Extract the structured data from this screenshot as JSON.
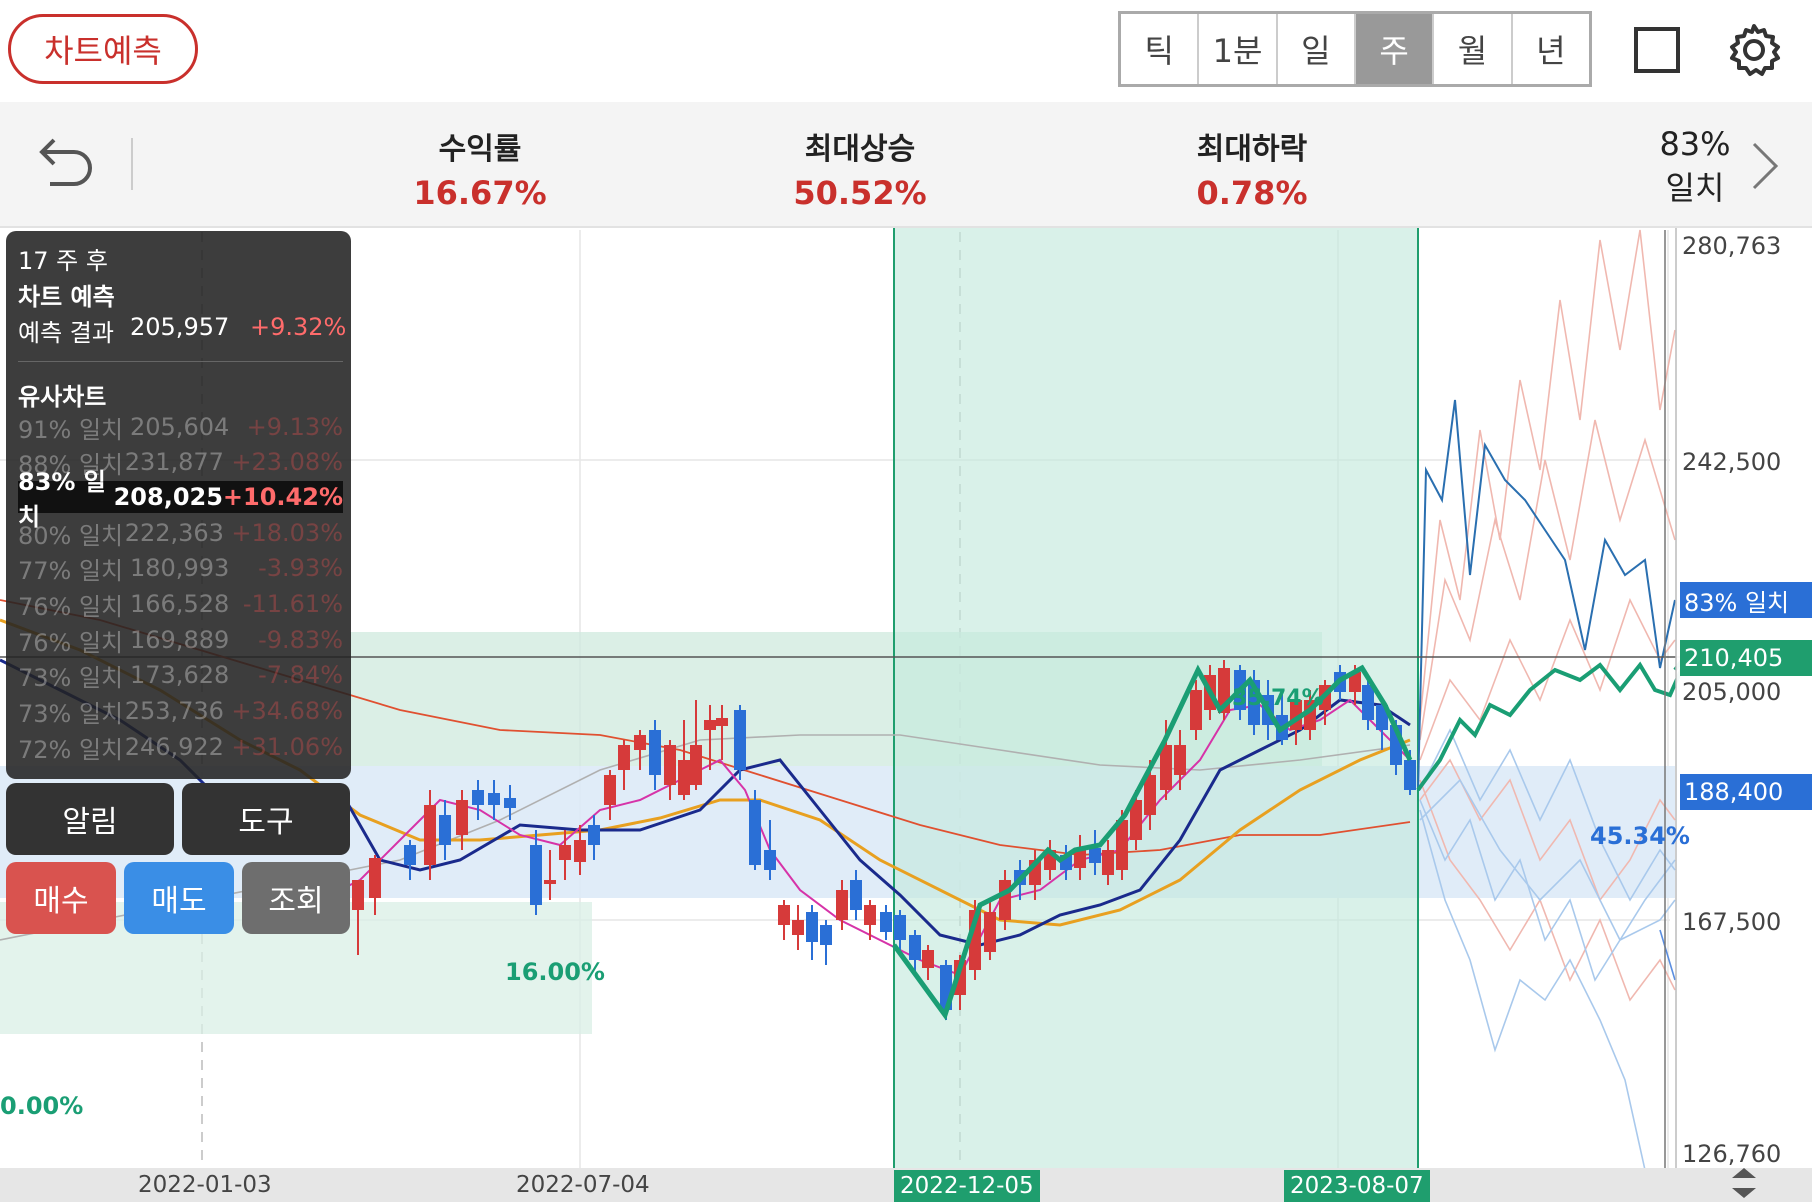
{
  "header": {
    "predict_button": "차트예측",
    "periods": [
      "틱",
      "1분",
      "일",
      "주",
      "월",
      "년"
    ],
    "active_period": "주"
  },
  "stats": {
    "return_label": "수익률",
    "return_value": "16.67%",
    "max_up_label": "최대상승",
    "max_up_value": "50.52%",
    "max_down_label": "최대하락",
    "max_down_value": "0.78%",
    "match_pct": "83%",
    "match_label": "일치"
  },
  "tooltip": {
    "weeks_after": "17 주 후",
    "title": "차트 예측",
    "result_label": "예측 결과",
    "result_value": "205,957",
    "result_change": "+9.32%",
    "similar_title": "유사차트",
    "similar": [
      {
        "pct": "91% 일치",
        "price": "205,604",
        "chg": "+9.13%"
      },
      {
        "pct": "88% 일치",
        "price": "231,877",
        "chg": "+23.08%"
      },
      {
        "pct": "83% 일치",
        "price": "208,025",
        "chg": "+10.42%"
      },
      {
        "pct": "80% 일치",
        "price": "222,363",
        "chg": "+18.03%"
      },
      {
        "pct": "77% 일치",
        "price": "180,993",
        "chg": "-3.93%"
      },
      {
        "pct": "76% 일치",
        "price": "166,528",
        "chg": "-11.61%"
      },
      {
        "pct": "76% 일치",
        "price": "169,889",
        "chg": "-9.83%"
      },
      {
        "pct": "73% 일치",
        "price": "173,628",
        "chg": "-7.84%"
      },
      {
        "pct": "73% 일치",
        "price": "253,736",
        "chg": "+34.68%"
      },
      {
        "pct": "72% 일치",
        "price": "246,922",
        "chg": "+31.06%"
      }
    ]
  },
  "buttons": {
    "alert": "알림",
    "tools": "도구",
    "buy": "매수",
    "sell": "매도",
    "query": "조회"
  },
  "chart_data": {
    "type": "candlestick",
    "y_axis_ticks": [
      "280,763",
      "242,500",
      "205,000",
      "167,500",
      "126,760"
    ],
    "x_axis_ticks": [
      "2022-01-03",
      "2022-07-04",
      "2022-12-05",
      "2023-08-07"
    ],
    "highlight_period": {
      "start": "2022-12-05",
      "end": "2023-08-07"
    },
    "current_price": "210,405",
    "price_tag_blue": "188,400",
    "match_tag": "83% 일치",
    "annotations": [
      "16.00%",
      "0.00%",
      "45.34%",
      "35.74%"
    ],
    "ma_periods": [
      "5",
      "10",
      "20",
      "60",
      "120"
    ],
    "colors": {
      "up": "#d63a3a",
      "down": "#2a6fd6",
      "ma5": "#d633a8",
      "ma10": "#1a2a8c",
      "ma20": "#e8a020",
      "ma60": "#e05030",
      "ma120": "#b0b0b0",
      "pattern": "#17a37a",
      "highlight": "#d6f0ea"
    }
  }
}
